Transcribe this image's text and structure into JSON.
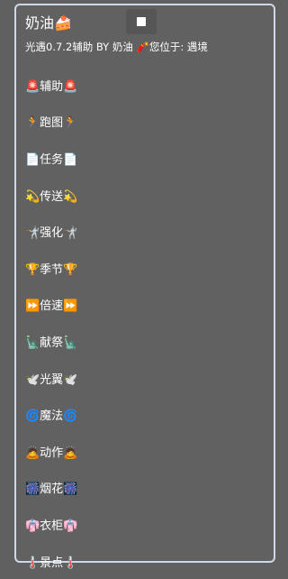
{
  "header": {
    "title": "奶油🍰",
    "stop_icon": "stop-square-icon"
  },
  "subtitle": "光遇0.7.2辅助 BY 奶油 🧨您位于: 遇境",
  "menu": {
    "items": [
      {
        "id": "assist",
        "label": "🚨辅助🚨"
      },
      {
        "id": "run-map",
        "label": "🏃跑图🏃"
      },
      {
        "id": "tasks",
        "label": "📄任务📄"
      },
      {
        "id": "teleport",
        "label": "💫传送💫"
      },
      {
        "id": "enhance",
        "label": "🤺强化🤺"
      },
      {
        "id": "season",
        "label": "🏆季节🏆"
      },
      {
        "id": "speed",
        "label": "⏩倍速⏩"
      },
      {
        "id": "offering",
        "label": "🗽献祭🗽"
      },
      {
        "id": "light-wings",
        "label": "🕊️光翼🕊️"
      },
      {
        "id": "magic",
        "label": "🌀魔法🌀"
      },
      {
        "id": "actions",
        "label": "🙇动作🙇"
      },
      {
        "id": "fireworks",
        "label": "🎆烟花🎆"
      },
      {
        "id": "wardrobe",
        "label": "👘衣柜👘"
      },
      {
        "id": "scenic-spots",
        "label": "🌡️景点🌡️"
      }
    ]
  }
}
